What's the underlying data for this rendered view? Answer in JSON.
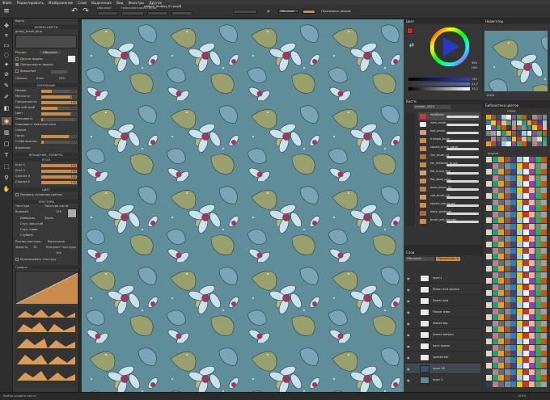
{
  "menu": [
    "Файл",
    "Редактировать",
    "Изображение",
    "Слой",
    "Выделение",
    "Вид",
    "Фильтры",
    "Другое"
  ],
  "toolbar": {
    "mode_label": "Обычный",
    "opacity_label": "Непрозрачность",
    "flow_label": "Поток",
    "tab_label": "pattern_fantasy_01.png@",
    "blend_label": "Обычный",
    "wrap_label": "Показывать режим"
  },
  "left": {
    "tool_options": "Кисть",
    "brush_shape_label": "ФОРМА КИСТИ",
    "brush_name": "grainy_brush_blue",
    "mode_label": "Режим:",
    "mode_value": "Обычный",
    "opt1": "Другие формы",
    "opt2": "Прозрачность формы",
    "opt3": "Вращение",
    "texture_opt": "Наклон",
    "keep_opt": "Блок",
    "grid_opt": "GPU",
    "basic_hdr": "ОСНОВНЫЕ",
    "basic": [
      {
        "label": "Размер",
        "value": "13,0",
        "fill": 0.3
      },
      {
        "label": "Мягкость",
        "value": "85,8",
        "fill": 0.86
      },
      {
        "label": "Прозрачность",
        "value": "100",
        "fill": 1.0
      },
      {
        "label": "Мягкий край",
        "value": "45,0",
        "fill": 0.45
      },
      {
        "label": "Цвет",
        "value": "81",
        "fill": 0.81
      },
      {
        "label": "Смешивать",
        "value": "4",
        "fill": 0.04
      }
    ],
    "basic_more": "Смешивать влажные слои",
    "pressure_label": "Нажим",
    "flow_row": {
      "label": "Поток",
      "value": "77,0",
      "fill": 0.77
    },
    "stab_row": {
      "label": "Стабилизатор",
      "value": "0,07",
      "fill": 0.07
    },
    "scatter": "Вариации",
    "scatter_hdr": "ВРАЩЕНИЕ, РАЗБРОС",
    "tilt_hdr": "УГОЛ",
    "tilt": [
      {
        "label": "Угол 1",
        "value": "100",
        "fill": 1.0
      },
      {
        "label": "Угол 2",
        "value": "100",
        "fill": 1.0
      },
      {
        "label": "Сжатие Х",
        "value": "100",
        "fill": 1.0
      },
      {
        "label": "Сжатие У",
        "value": "100",
        "fill": 1.0
      }
    ],
    "color_hdr": "ЦВЕТ",
    "color_opt": "Рисовать основным цветом",
    "texture_hdr": "ТЕКСТУРА",
    "texture_tab1": "Текстура",
    "texture_tab2": "Текстура кисти",
    "texture_name": "Raisecell",
    "texture_value": "128",
    "texture_opts": [
      "Инверсия",
      "Зерно",
      "Случ. масштаб",
      "Случ. сдвиг",
      "Глубина"
    ],
    "texture_mode_label": "Режим текстуры",
    "texture_mode_value": "Вычитание",
    "brightness": "Яркость",
    "contrast": "Контраст текстуры",
    "brightness_value": "35",
    "contrast_value": "100",
    "keep_opt2": "Использовать текстуру",
    "graph_label": "График"
  },
  "color": {
    "title": "Цвет",
    "h": "240",
    "s": "33,7",
    "v": "33,2",
    "hex": "HSV",
    "num": "960"
  },
  "navigator": {
    "title": "Навигатор",
    "zoom": "100%"
  },
  "brushes": {
    "title": "Кисти",
    "set_name": "marker_2023",
    "items": [
      "inkWBrise",
      "lines_brush",
      "text_brush",
      "triangle_brush",
      "square_brush_blend",
      "line_brush_rd",
      "fan_flattened_brush",
      "flat_brush_fine",
      "flat_deep_color",
      "wash_brush_03",
      "soft_brush_15",
      "square_wet_brush",
      "black_wetbrush",
      "brush_wet_blender"
    ]
  },
  "layers": {
    "title": "Слои",
    "blend": "Обычный",
    "opacity": "Прозрачность",
    "items": [
      {
        "name": "layer1",
        "color": "#e8e8e8"
      },
      {
        "name": "flower add splatch",
        "color": "#e8e8e8"
      },
      {
        "name": "flower add",
        "color": "#e8e8e8"
      },
      {
        "name": "Flower base",
        "color": "#e8e8e8"
      },
      {
        "name": "leaves top",
        "color": "#e8e8e8"
      },
      {
        "name": "leaves bottom",
        "color": "#e8e8e8"
      },
      {
        "name": "back leaves",
        "color": "#e8e8e8"
      },
      {
        "name": "splatteredr",
        "color": "#e8e8e8"
      },
      {
        "name": "layer 16",
        "color": "#3d5270"
      },
      {
        "name": "layer 3",
        "color": "#5e8c97"
      }
    ]
  },
  "swatches": {
    "title": "Библиотека цветов",
    "set": "COPIC",
    "section": "original"
  },
  "status": {
    "left": "Выбор ширины кисти",
    "zoom": "100%"
  }
}
